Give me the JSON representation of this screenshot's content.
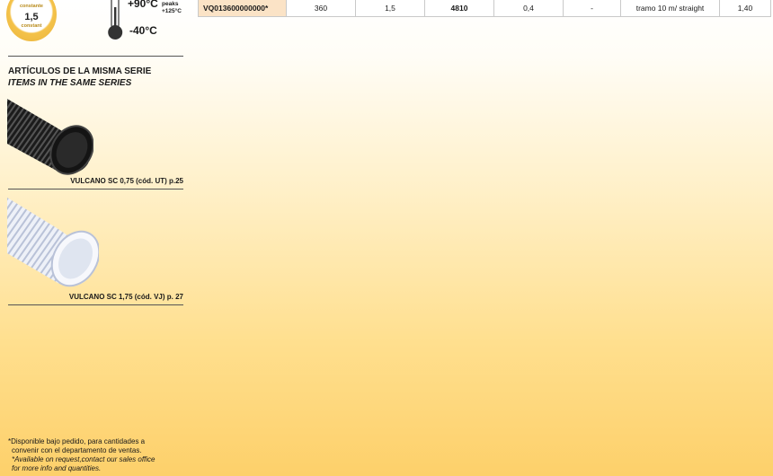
{
  "badge": {
    "top_label": "constante",
    "value": "1,5",
    "bottom_label": "constant"
  },
  "temperature": {
    "max": "+90°C",
    "peaks_label": "peaks",
    "peaks_value": "+125°C",
    "min": "-40°C"
  },
  "series": {
    "title_es": "ARTÍCULOS DE LA MISMA SERIE",
    "title_en": "ITEMS IN THE SAME SERIES",
    "items": [
      {
        "caption": "VULCANO SC 0,75 (cód. UT)  p.25"
      },
      {
        "caption": "VULCANO SC 1,75 (cód. VJ) p. 27"
      }
    ]
  },
  "spec_row": {
    "code": "VQ013600000000*",
    "cells": [
      "360",
      "1,5",
      "4810",
      "0,4",
      "-",
      "tramo 10 m/ straight",
      "1,40"
    ]
  },
  "footnote": {
    "es_line1": "*Disponible bajo pedido, para cantidades a",
    "es_line2": "convenir con el departamento de ventas.",
    "en_line1": "*Available on request,contact our sales office",
    "en_line2": "for more info and quantities."
  },
  "colors": {
    "accent_gold": "#f4c24a",
    "code_cell": "#fbe3c6"
  }
}
